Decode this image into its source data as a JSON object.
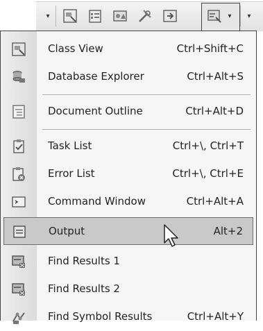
{
  "toolbar": {
    "buttons": [
      {
        "icon": "class-view-icon"
      },
      {
        "icon": "properties-icon"
      },
      {
        "icon": "resource-view-icon"
      },
      {
        "icon": "toolbox-icon"
      },
      {
        "icon": "start-page-icon"
      },
      {
        "icon": "other-windows-icon"
      }
    ]
  },
  "menu": {
    "items": [
      {
        "label": "Class View",
        "shortcut": "Ctrl+Shift+C",
        "icon": "class-view-icon"
      },
      {
        "label": "Database Explorer",
        "shortcut": "Ctrl+Alt+S",
        "icon": "database-explorer-icon"
      },
      {
        "label": "Document Outline",
        "shortcut": "Ctrl+Alt+D",
        "icon": "document-outline-icon"
      },
      {
        "label": "Task List",
        "shortcut": "Ctrl+\\, Ctrl+T",
        "icon": "task-list-icon"
      },
      {
        "label": "Error List",
        "shortcut": "Ctrl+\\, Ctrl+E",
        "icon": "error-list-icon"
      },
      {
        "label": "Command Window",
        "shortcut": "Ctrl+Alt+A",
        "icon": "command-window-icon"
      },
      {
        "label": "Output",
        "shortcut": "Alt+2",
        "icon": "output-icon"
      },
      {
        "label": "Find Results 1",
        "shortcut": "",
        "icon": "find-results-icon"
      },
      {
        "label": "Find Results 2",
        "shortcut": "",
        "icon": "find-results-icon"
      },
      {
        "label": "Find Symbol Results",
        "shortcut": "Ctrl+Alt+Y",
        "icon": "find-symbol-icon"
      }
    ],
    "highlighted_index": 6
  }
}
